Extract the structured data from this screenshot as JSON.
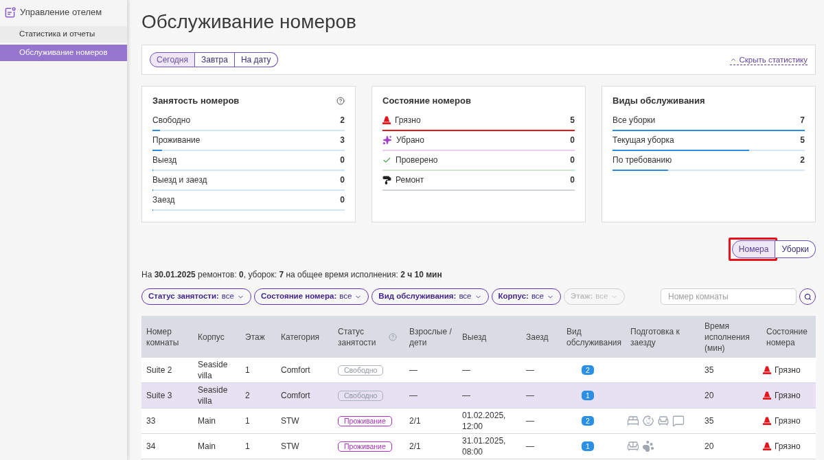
{
  "sidebar": {
    "title": "Управление отелем",
    "items": [
      {
        "label": "Статистика и отчеты",
        "selected": false
      },
      {
        "label": "Обслуживание номеров",
        "selected": true
      }
    ]
  },
  "page_title": "Обслуживание номеров",
  "stats_panel": {
    "periods": [
      {
        "label": "Сегодня",
        "selected": true
      },
      {
        "label": "Завтра",
        "selected": false
      },
      {
        "label": "На дату",
        "selected": false
      }
    ],
    "hide_link": "Скрыть статистику"
  },
  "stat_cards": [
    {
      "title": "Занятость номеров",
      "help": true,
      "rows": [
        {
          "label": "Свободно",
          "value": "2",
          "level": 0.04
        },
        {
          "label": "Проживание",
          "value": "3",
          "level": 0.05
        },
        {
          "label": "Выезд",
          "value": "0",
          "level": 0
        },
        {
          "label": "Выезд и заезд",
          "value": "0",
          "level": 0
        },
        {
          "label": "Заезд",
          "value": "0",
          "level": 0
        }
      ]
    },
    {
      "title": "Состояние номеров",
      "help": false,
      "rows": [
        {
          "kind": "dirty",
          "label": "Грязно",
          "value": "5",
          "color": "#e3161b"
        },
        {
          "kind": "cleaned",
          "label": "Убрано",
          "value": "0",
          "color": "#ebcdf0"
        },
        {
          "kind": "checked",
          "label": "Проверено",
          "value": "0",
          "color": "#cfe6cf"
        },
        {
          "kind": "repair",
          "label": "Ремонт",
          "value": "0",
          "color": "#cfd4da"
        }
      ]
    },
    {
      "title": "Виды обслуживания",
      "help": false,
      "rows": [
        {
          "label": "Все уборки",
          "value": "7",
          "level": 1
        },
        {
          "label": "Текущая уборка",
          "value": "5",
          "level": 0.71
        },
        {
          "label": "По требованию",
          "value": "2",
          "level": 0.29
        }
      ]
    }
  ],
  "view_toggle": [
    {
      "label": "Номера",
      "selected": true,
      "highlighted": true
    },
    {
      "label": "Уборки",
      "selected": false,
      "highlighted": false
    }
  ],
  "summary": "На **30.01.2025** ремонтов: **0**, уборок: **7** на общее время исполнения: **2 ч 10 мин**",
  "filters": [
    {
      "label": "Статус занятости:",
      "value": "все",
      "disabled": false
    },
    {
      "label": "Состояние номера:",
      "value": "все",
      "disabled": false
    },
    {
      "label": "Вид обслуживания:",
      "value": "все",
      "disabled": false
    },
    {
      "label": "Корпус:",
      "value": "все",
      "disabled": false
    },
    {
      "label": "Этаж:",
      "value": "все",
      "disabled": true
    }
  ],
  "room_search": {
    "placeholder": "Номер комнаты"
  },
  "table": {
    "columns": [
      {
        "label": "Номер комнаты",
        "help": false
      },
      {
        "label": "Корпус",
        "help": false
      },
      {
        "label": "Этаж",
        "help": false
      },
      {
        "label": "Категория",
        "help": false
      },
      {
        "label": "Статус занятости",
        "help": true
      },
      {
        "label": "Взрослые / дети",
        "help": false
      },
      {
        "label": "Выезд",
        "help": false
      },
      {
        "label": "Заезд",
        "help": false
      },
      {
        "label": "Вид обслуживания",
        "help": false
      },
      {
        "label": "Подготовка к заезду",
        "help": false
      },
      {
        "label": "Время исполнения (мин)",
        "help": false
      },
      {
        "label": "Состояние номера",
        "help": false
      }
    ],
    "rows": [
      {
        "selected": false,
        "room": "Suite 2",
        "building": "Seaside villa",
        "floor": "1",
        "category": "Comfort",
        "occupancy": {
          "label": "Свободно",
          "kind": "free"
        },
        "guests": "—",
        "departure": "—",
        "arrival": "—",
        "service_count": "2",
        "duration": "35",
        "condition": {
          "label": "Грязно",
          "kind": "dirty"
        }
      },
      {
        "selected": true,
        "room": "Suite 3",
        "building": "Seaside villa",
        "floor": "2",
        "category": "Comfort",
        "occupancy": {
          "label": "Свободно",
          "kind": "free"
        },
        "guests": "—",
        "departure": "—",
        "arrival": "—",
        "service_count": "1",
        "duration": "20",
        "condition": {
          "label": "Грязно",
          "kind": "dirty"
        }
      },
      {
        "selected": false,
        "room": "33",
        "building": "Main",
        "floor": "1",
        "category": "STW",
        "occupancy": {
          "label": "Проживание",
          "kind": "living"
        },
        "guests": "2/1",
        "departure": "01.02.2025, 12:00",
        "arrival": "—",
        "service_count": "2",
        "prep": [
          {
            "kind": "bed"
          },
          {
            "kind": "baby"
          },
          {
            "kind": "seat"
          },
          {
            "kind": "comment"
          }
        ],
        "duration": "35",
        "condition": {
          "label": "Грязно",
          "kind": "dirty"
        }
      },
      {
        "selected": false,
        "room": "34",
        "building": "Main",
        "floor": "1",
        "category": "STW",
        "occupancy": {
          "label": "Проживание",
          "kind": "living"
        },
        "guests": "2/1",
        "departure": "31.01.2025, 08:00",
        "arrival": "—",
        "service_count": "1",
        "prep": [
          {
            "kind": "extra_bed"
          },
          {
            "kind": "pet"
          }
        ],
        "duration": "20",
        "condition": {
          "label": "Грязно",
          "kind": "dirty"
        }
      }
    ]
  }
}
